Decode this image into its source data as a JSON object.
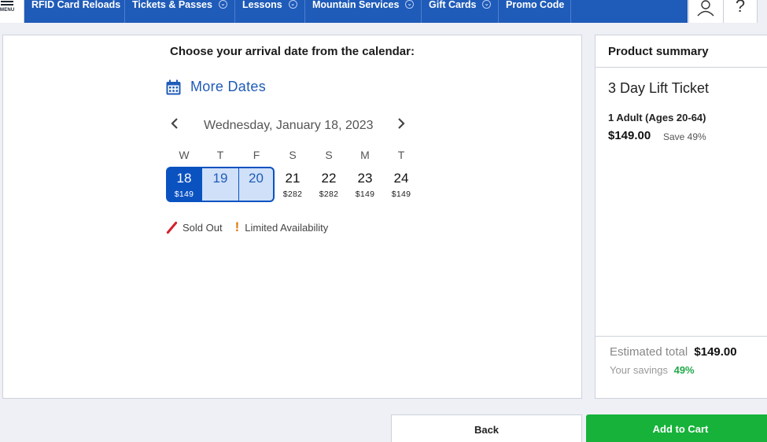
{
  "header": {
    "menu_label": "MENU",
    "nav": [
      {
        "label": "RFID Card Reloads",
        "dropdown": false
      },
      {
        "label": "Tickets & Passes",
        "dropdown": true
      },
      {
        "label": "Lessons",
        "dropdown": true
      },
      {
        "label": "Mountain Services",
        "dropdown": true
      },
      {
        "label": "Gift Cards",
        "dropdown": true
      },
      {
        "label": "Promo Code",
        "dropdown": false
      }
    ],
    "help_glyph": "?",
    "icons": [
      "menu-icon",
      "user-icon",
      "help-icon",
      "chevron-down-icon"
    ]
  },
  "calendar": {
    "heading": "Choose your arrival date from the calendar:",
    "more_dates": "More Dates",
    "current_date": "Wednesday, January 18, 2023",
    "weekdays": [
      "W",
      "T",
      "F",
      "S",
      "S",
      "M",
      "T"
    ],
    "days": [
      {
        "num": "18",
        "price": "$149",
        "state": "selected-start"
      },
      {
        "num": "19",
        "price": "",
        "state": "selected-mid"
      },
      {
        "num": "20",
        "price": "",
        "state": "selected-end"
      },
      {
        "num": "21",
        "price": "$282",
        "state": "available"
      },
      {
        "num": "22",
        "price": "$282",
        "state": "available"
      },
      {
        "num": "23",
        "price": "$149",
        "state": "available"
      },
      {
        "num": "24",
        "price": "$149",
        "state": "available"
      }
    ],
    "legend": {
      "sold_out": "Sold Out",
      "limited": "Limited Availability"
    }
  },
  "summary": {
    "title": "Product summary",
    "product": "3 Day Lift Ticket",
    "quantity": "1 Adult (Ages 20-64)",
    "price": "$149.00",
    "save": "Save 49%",
    "estimated_label": "Estimated total",
    "estimated_value": "$149.00",
    "savings_label": "Your savings",
    "savings_value": "49%"
  },
  "actions": {
    "back": "Back",
    "add_to_cart": "Add to Cart"
  },
  "colors": {
    "brand_blue": "#1f5bb8",
    "selected_blue": "#0b52c1",
    "range_fill": "#cfe0f8",
    "cart_green": "#17b23a",
    "sold_out_red": "#d4202a",
    "limited_orange": "#e07a10",
    "savings_green": "#22a94a"
  }
}
